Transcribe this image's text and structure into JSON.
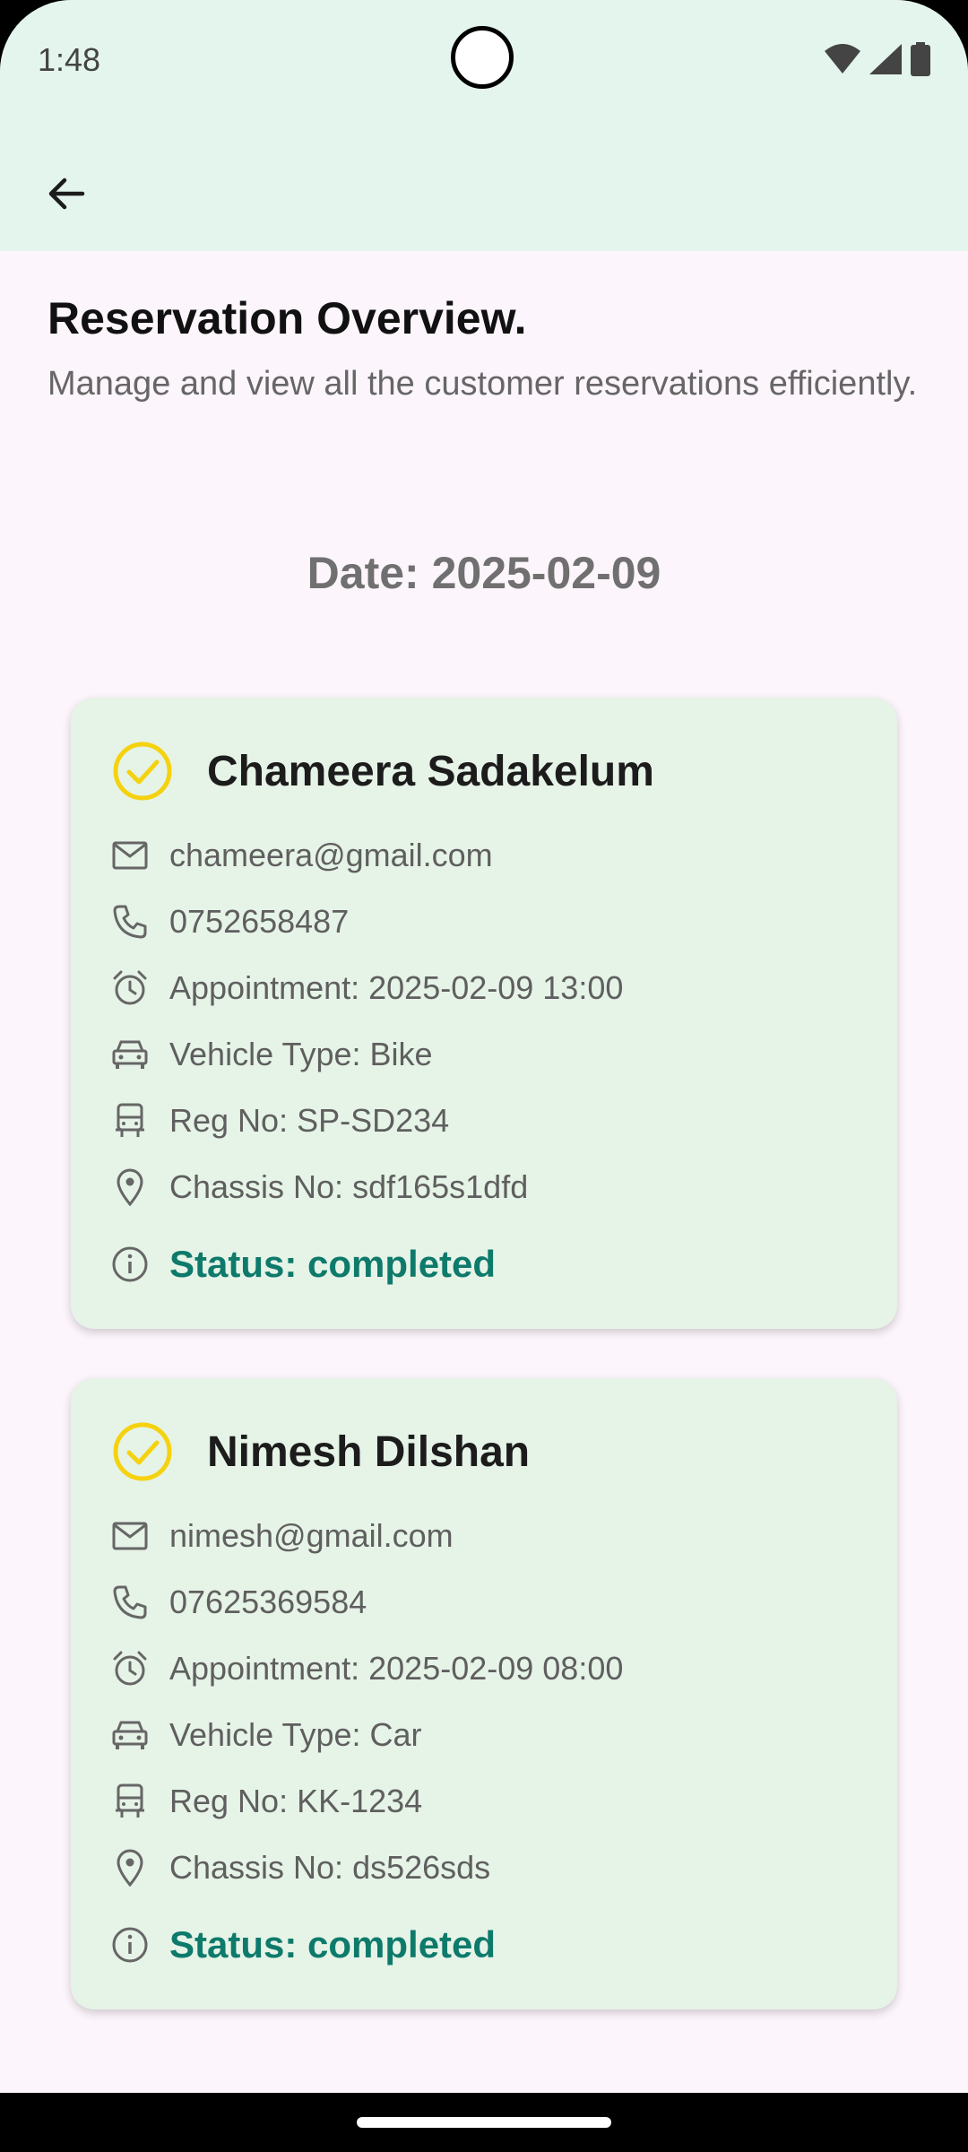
{
  "status_bar": {
    "time": "1:48",
    "icons": [
      "wifi-icon",
      "signal-icon",
      "battery-icon"
    ]
  },
  "app_bar": {
    "back_icon": "arrow-left-icon"
  },
  "header": {
    "title": "Reservation Overview.",
    "subtitle": "Manage and view all the customer reservations efficiently."
  },
  "date_label": "Date: 2025-02-09",
  "colors": {
    "app_bar_bg": "#e3f5ec",
    "page_bg": "#fcf5fb",
    "card_bg": "#e6f3e7",
    "check_icon": "#f5d20e",
    "status_text": "#0d7a6b"
  },
  "reservations": [
    {
      "name": "Chameera Sadakelum",
      "email": "chameera@gmail.com",
      "phone": "0752658487",
      "appointment": "Appointment: 2025-02-09 13:00",
      "vehicle_type": "Vehicle Type: Bike",
      "reg_no": "Reg No: SP-SD234",
      "chassis_no": "Chassis No: sdf165s1dfd",
      "status": "Status: completed"
    },
    {
      "name": "Nimesh Dilshan",
      "email": "nimesh@gmail.com",
      "phone": "07625369584",
      "appointment": "Appointment: 2025-02-09 08:00",
      "vehicle_type": "Vehicle Type: Car",
      "reg_no": "Reg No: KK-1234",
      "chassis_no": "Chassis No: ds526sds",
      "status": "Status: completed"
    }
  ]
}
